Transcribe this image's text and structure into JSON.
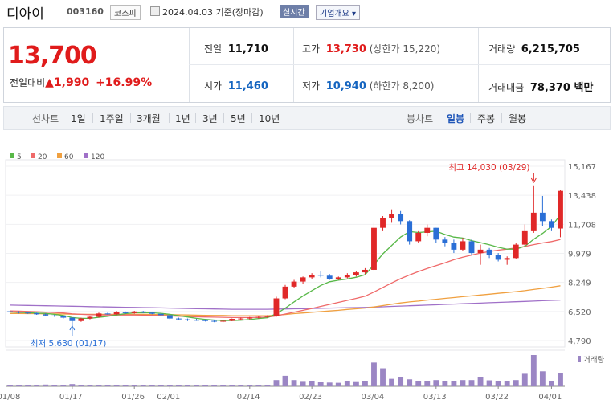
{
  "header": {
    "name": "디아이",
    "code": "003160",
    "market": "코스피",
    "date": "2024.04.03 기준(장마감)",
    "realtime": "실시간",
    "overview": "기업개요"
  },
  "quote": {
    "price": "13,700",
    "change_label": "전일대비",
    "change": "▲1,990",
    "change_pct": "+16.99%",
    "prev_label": "전일",
    "prev": "11,710",
    "high_label": "고가",
    "high": "13,730",
    "upper_label": "(상한가 15,220)",
    "volume_label": "거래량",
    "volume": "6,215,705",
    "open_label": "시가",
    "open": "11,460",
    "low_label": "저가",
    "low": "10,940",
    "lower_label": "(하한가 8,200)",
    "amount_label": "거래대금",
    "amount": "78,370 백만"
  },
  "tabs": {
    "line_label": "선차트",
    "line_items": [
      "1일",
      "1주일",
      "3개월",
      "1년",
      "3년",
      "5년",
      "10년"
    ],
    "candle_label": "봉차트",
    "candle_items": [
      "일봉",
      "주봉",
      "월봉"
    ],
    "active_candle": "일봉"
  },
  "colors": {
    "up": "#e02828",
    "down": "#2a6fd6",
    "ma5": "#58b848",
    "ma20": "#ef6a6a",
    "ma60": "#f0a040",
    "ma120": "#a070c8",
    "volume": "#9b86c4"
  },
  "chart_data": {
    "type": "candlestick",
    "legend": [
      {
        "name": "5",
        "color": "#58b848"
      },
      {
        "name": "20",
        "color": "#ef6a6a"
      },
      {
        "name": "60",
        "color": "#f0a040"
      },
      {
        "name": "120",
        "color": "#a070c8"
      }
    ],
    "y_ticks": [
      "15,167",
      "13,438",
      "11,708",
      "9,979",
      "8,249",
      "6,520",
      "4,790"
    ],
    "ylim": [
      4790,
      15167
    ],
    "x_ticks": [
      "01/08",
      "01/17",
      "01/26",
      "02/01",
      "02/14",
      "02/23",
      "03/04",
      "03/13",
      "03/22",
      "04/01"
    ],
    "annotations": {
      "high": "최고 14,030 (03/29)",
      "low": "최저 5,630 (01/17)"
    },
    "volume_label": "거래량",
    "candles": [
      [
        6530,
        6580,
        6460,
        6500
      ],
      [
        6500,
        6540,
        6400,
        6450
      ],
      [
        6450,
        6500,
        6380,
        6420
      ],
      [
        6420,
        6450,
        6320,
        6350
      ],
      [
        6350,
        6400,
        6250,
        6280
      ],
      [
        6280,
        6320,
        6200,
        6230
      ],
      [
        6230,
        6260,
        6100,
        6150
      ],
      [
        6150,
        6180,
        5630,
        5950
      ],
      [
        5950,
        6150,
        5900,
        6100
      ],
      [
        6100,
        6250,
        6050,
        6200
      ],
      [
        6200,
        6450,
        6150,
        6400
      ],
      [
        6400,
        6450,
        6320,
        6350
      ],
      [
        6350,
        6550,
        6300,
        6500
      ],
      [
        6500,
        6520,
        6380,
        6420
      ],
      [
        6420,
        6560,
        6380,
        6520
      ],
      [
        6520,
        6550,
        6420,
        6450
      ],
      [
        6450,
        6500,
        6350,
        6380
      ],
      [
        6380,
        6420,
        6280,
        6300
      ],
      [
        6300,
        6320,
        6050,
        6100
      ],
      [
        6100,
        6150,
        6000,
        6050
      ],
      [
        6050,
        6100,
        5950,
        6020
      ],
      [
        6020,
        6080,
        5960,
        6000
      ],
      [
        6000,
        6050,
        5920,
        5960
      ],
      [
        5960,
        6000,
        5880,
        5920
      ],
      [
        5920,
        6000,
        5880,
        5960
      ],
      [
        5960,
        6100,
        5940,
        6080
      ],
      [
        6080,
        6150,
        6020,
        6100
      ],
      [
        6100,
        6200,
        6050,
        6150
      ],
      [
        6150,
        6250,
        6100,
        6200
      ],
      [
        6200,
        6300,
        6150,
        6250
      ],
      [
        6250,
        7400,
        6200,
        7300
      ],
      [
        7300,
        8100,
        7250,
        8000
      ],
      [
        8000,
        8400,
        7900,
        8300
      ],
      [
        8300,
        8600,
        8150,
        8550
      ],
      [
        8550,
        8800,
        8450,
        8700
      ],
      [
        8700,
        8900,
        8550,
        8650
      ],
      [
        8650,
        8750,
        8400,
        8450
      ],
      [
        8450,
        8600,
        8380,
        8550
      ],
      [
        8550,
        8800,
        8500,
        8700
      ],
      [
        8700,
        8950,
        8600,
        8850
      ],
      [
        8850,
        9100,
        8750,
        9000
      ],
      [
        9000,
        11800,
        8950,
        11500
      ],
      [
        11500,
        12200,
        11300,
        12100
      ],
      [
        12100,
        12600,
        11800,
        12300
      ],
      [
        12300,
        12500,
        11700,
        11900
      ],
      [
        11900,
        11950,
        10500,
        10700
      ],
      [
        10700,
        11300,
        10600,
        11200
      ],
      [
        11200,
        11700,
        11000,
        11500
      ],
      [
        11500,
        11500,
        10600,
        10800
      ],
      [
        10800,
        10950,
        10400,
        10600
      ],
      [
        10600,
        10800,
        10000,
        10200
      ],
      [
        10200,
        10900,
        10100,
        10700
      ],
      [
        10700,
        10800,
        9900,
        10000
      ],
      [
        10000,
        10500,
        9300,
        10200
      ],
      [
        10200,
        10300,
        9700,
        9900
      ],
      [
        9900,
        10000,
        9500,
        9600
      ],
      [
        9600,
        9800,
        9300,
        9700
      ],
      [
        9700,
        10600,
        9650,
        10500
      ],
      [
        10500,
        11700,
        10400,
        11300
      ],
      [
        11300,
        14030,
        11200,
        12400
      ],
      [
        12400,
        13400,
        11600,
        11900
      ],
      [
        11900,
        12000,
        11300,
        11500
      ],
      [
        11460,
        13730,
        10940,
        13700
      ]
    ],
    "volumes": [
      0.6,
      0.5,
      0.5,
      0.5,
      0.7,
      0.6,
      0.6,
      0.9,
      0.6,
      0.5,
      0.6,
      0.5,
      0.6,
      0.5,
      0.6,
      0.5,
      0.5,
      0.5,
      0.6,
      0.5,
      0.5,
      0.4,
      0.5,
      0.5,
      0.5,
      0.5,
      0.5,
      0.5,
      0.5,
      0.6,
      2.5,
      4.2,
      2.5,
      1.8,
      2.2,
      1.6,
      1.5,
      1.4,
      2.0,
      1.7,
      2.0,
      9.5,
      7.2,
      3.0,
      3.8,
      2.8,
      2.0,
      2.2,
      2.5,
      2.0,
      2.0,
      2.5,
      2.5,
      3.8,
      2.4,
      2.0,
      2.0,
      2.5,
      5.0,
      12.5,
      6.0,
      2.0,
      5.2
    ],
    "ma5": [
      6490,
      6470,
      6450,
      6420,
      6400,
      6350,
      6280,
      6160,
      6110,
      6110,
      6170,
      6230,
      6310,
      6390,
      6440,
      6450,
      6440,
      6410,
      6350,
      6270,
      6190,
      6110,
      6050,
      6010,
      5980,
      5980,
      6000,
      6040,
      6100,
      6150,
      6390,
      6710,
      7090,
      7440,
      7760,
      8070,
      8290,
      8380,
      8460,
      8560,
      8710,
      9300,
      9950,
      10450,
      10950,
      11280,
      11220,
      11260,
      11300,
      11100,
      10950,
      10890,
      10740,
      10620,
      10490,
      10340,
      10230,
      10230,
      10400,
      10820,
      11170,
      11580,
      12280
    ],
    "ma20": [
      6550,
      6540,
      6520,
      6500,
      6480,
      6460,
      6430,
      6380,
      6350,
      6330,
      6320,
      6310,
      6310,
      6310,
      6310,
      6300,
      6290,
      6280,
      6260,
      6240,
      6220,
      6200,
      6190,
      6180,
      6170,
      6160,
      6160,
      6160,
      6170,
      6180,
      6260,
      6370,
      6480,
      6590,
      6700,
      6820,
      6940,
      7060,
      7180,
      7300,
      7430,
      7680,
      7950,
      8220,
      8470,
      8690,
      8900,
      9080,
      9250,
      9420,
      9600,
      9750,
      9880,
      10000,
      10090,
      10170,
      10230,
      10300,
      10390,
      10500,
      10600,
      10680,
      10800
    ],
    "ma60": [
      6400,
      6400,
      6390,
      6390,
      6380,
      6380,
      6370,
      6360,
      6350,
      6350,
      6350,
      6350,
      6350,
      6350,
      6350,
      6350,
      6340,
      6340,
      6330,
      6320,
      6310,
      6300,
      6290,
      6280,
      6280,
      6270,
      6270,
      6270,
      6270,
      6270,
      6300,
      6340,
      6390,
      6430,
      6470,
      6510,
      6550,
      6590,
      6640,
      6680,
      6720,
      6790,
      6870,
      6950,
      7030,
      7090,
      7140,
      7200,
      7250,
      7300,
      7350,
      7400,
      7450,
      7500,
      7550,
      7600,
      7650,
      7700,
      7760,
      7830,
      7900,
      7970,
      8050
    ],
    "ma120": [
      6900,
      6890,
      6880,
      6870,
      6860,
      6850,
      6840,
      6830,
      6820,
      6810,
      6800,
      6790,
      6780,
      6770,
      6760,
      6750,
      6740,
      6730,
      6720,
      6710,
      6700,
      6690,
      6680,
      6670,
      6660,
      6650,
      6650,
      6650,
      6650,
      6650,
      6660,
      6670,
      6680,
      6690,
      6700,
      6710,
      6720,
      6730,
      6740,
      6750,
      6760,
      6780,
      6800,
      6820,
      6840,
      6860,
      6880,
      6900,
      6920,
      6940,
      6960,
      6980,
      7000,
      7020,
      7040,
      7060,
      7080,
      7100,
      7120,
      7140,
      7160,
      7180,
      7200
    ]
  }
}
